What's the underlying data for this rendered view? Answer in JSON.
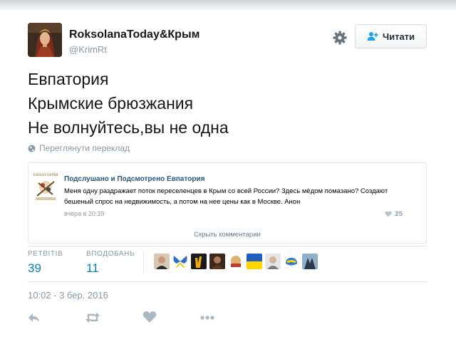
{
  "profile": {
    "name": "RoksolanaToday&Крым",
    "handle": "@KrimRt",
    "follow_label": "Читати"
  },
  "tweet": {
    "lines": [
      "Евпатория",
      "Крымские брюзжания",
      "Не волнуйтесь,вы не одна"
    ],
    "translate_label": "Переглянути переклад"
  },
  "embed": {
    "title": "Подслушано и Подсмотрено Евпатория",
    "text": "Меня одну раздражает поток переселенцев в Крым со всей России? Здесь мёдом помазано? Создают бешеный спрос на недвижимость, а потом на нее цены как в Москве. Анон",
    "time": "вчера в 20:39",
    "likes": "25",
    "hide_comments": "Скрыть комментарии"
  },
  "stats": {
    "retweets_label": "РЕТВІТІВ",
    "retweets": "39",
    "likes_label": "ВПОДОБАНЬ",
    "likes": "11"
  },
  "timestamp": "10:02 - 3 бер. 2016",
  "colors": {
    "link": "#0084b4",
    "muted": "#8899a6",
    "vk_title": "#2b587a"
  }
}
